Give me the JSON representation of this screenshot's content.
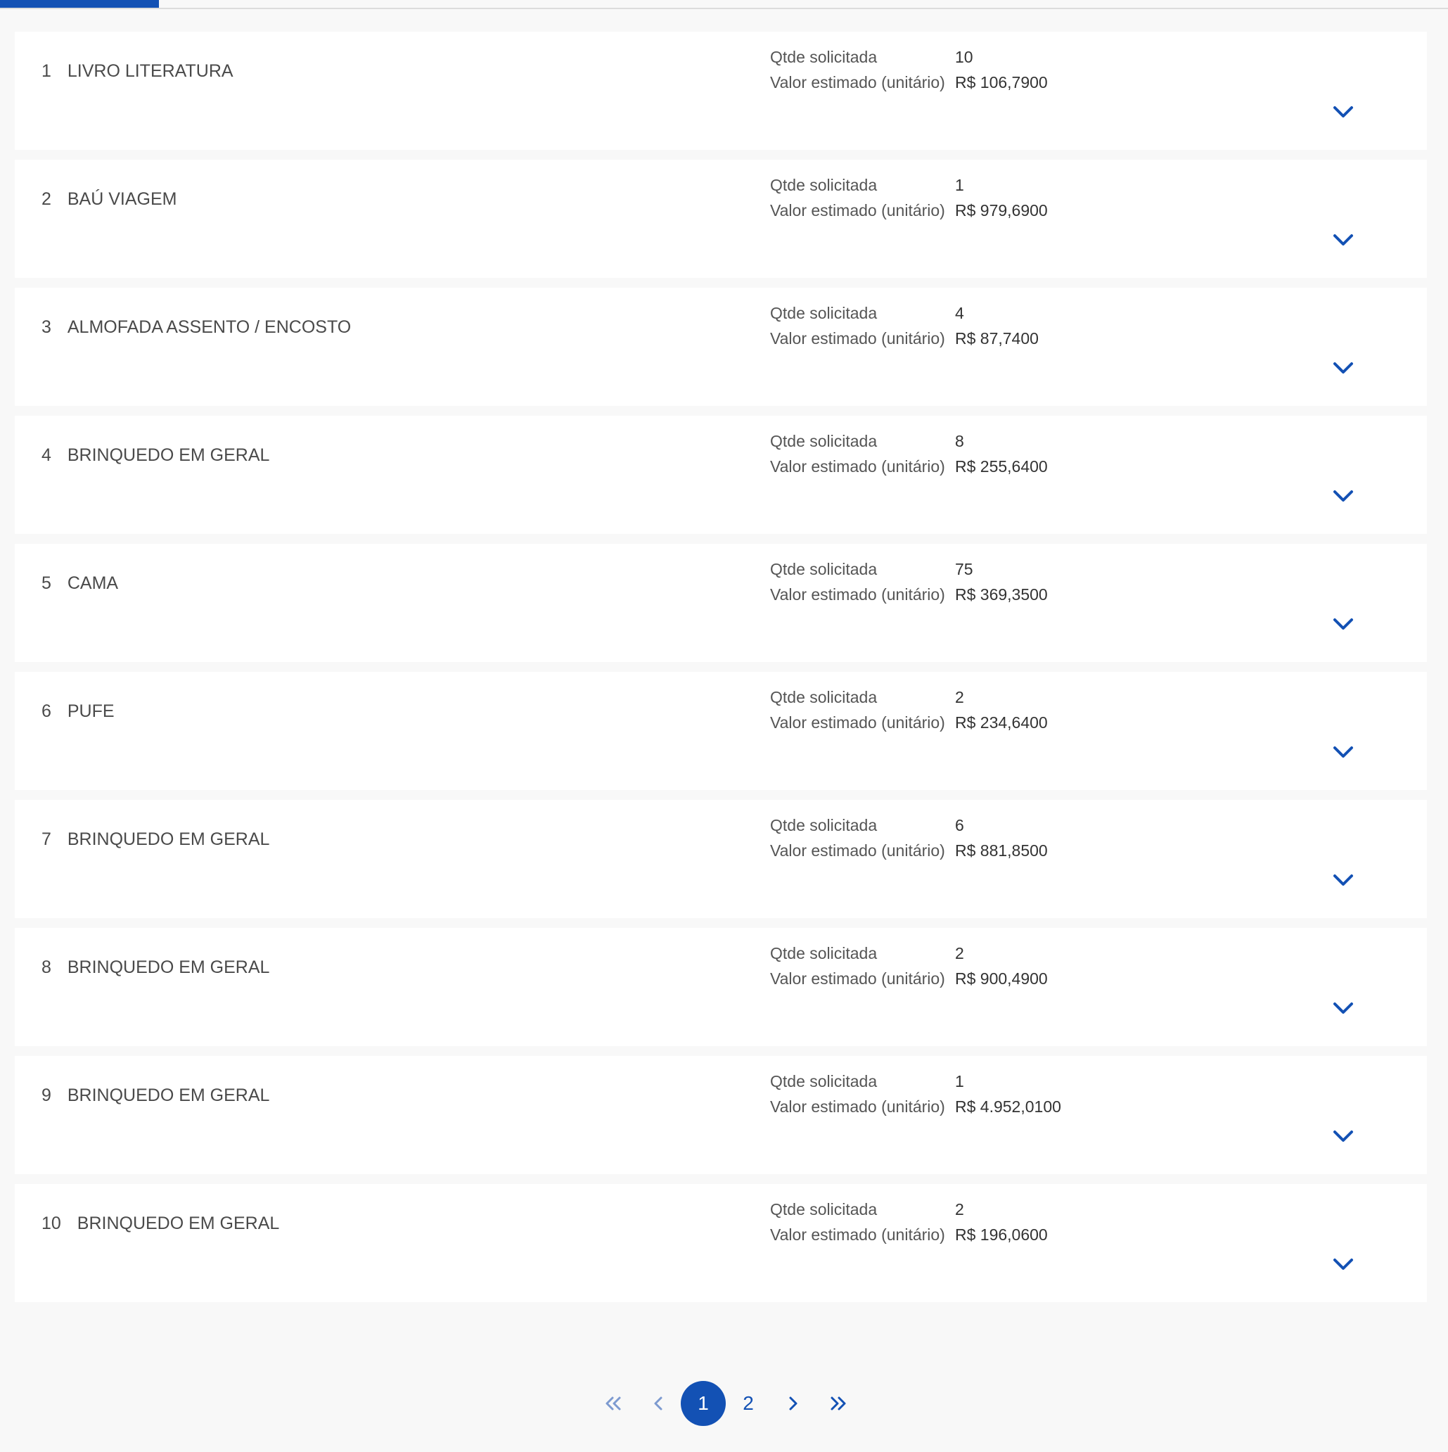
{
  "labels": {
    "qty": "Qtde solicitada",
    "value": "Valor estimado (unitário)"
  },
  "items": [
    {
      "number": "1",
      "name": "LIVRO LITERATURA",
      "qty": "10",
      "value": "R$ 106,7900"
    },
    {
      "number": "2",
      "name": "BAÚ VIAGEM",
      "qty": "1",
      "value": "R$ 979,6900"
    },
    {
      "number": "3",
      "name": "ALMOFADA ASSENTO / ENCOSTO",
      "qty": "4",
      "value": "R$ 87,7400"
    },
    {
      "number": "4",
      "name": "BRINQUEDO EM GERAL",
      "qty": "8",
      "value": "R$ 255,6400"
    },
    {
      "number": "5",
      "name": "CAMA",
      "qty": "75",
      "value": "R$ 369,3500"
    },
    {
      "number": "6",
      "name": "PUFE",
      "qty": "2",
      "value": "R$ 234,6400"
    },
    {
      "number": "7",
      "name": "BRINQUEDO EM GERAL",
      "qty": "6",
      "value": "R$ 881,8500"
    },
    {
      "number": "8",
      "name": "BRINQUEDO EM GERAL",
      "qty": "2",
      "value": "R$ 900,4900"
    },
    {
      "number": "9",
      "name": "BRINQUEDO EM GERAL",
      "qty": "1",
      "value": "R$ 4.952,0100"
    },
    {
      "number": "10",
      "name": "BRINQUEDO EM GERAL",
      "qty": "2",
      "value": "R$ 196,0600"
    }
  ],
  "icons": {
    "expand": "chevron-down-icon",
    "first": "double-chevron-left-icon",
    "prev": "chevron-left-icon",
    "next": "chevron-right-icon",
    "last": "double-chevron-right-icon"
  },
  "pagination": {
    "pages": [
      "1",
      "2"
    ],
    "current": "1"
  },
  "colors": {
    "accent": "#1351b4",
    "background": "#f8f8f8",
    "card": "#ffffff",
    "text": "#4a4a4a"
  }
}
